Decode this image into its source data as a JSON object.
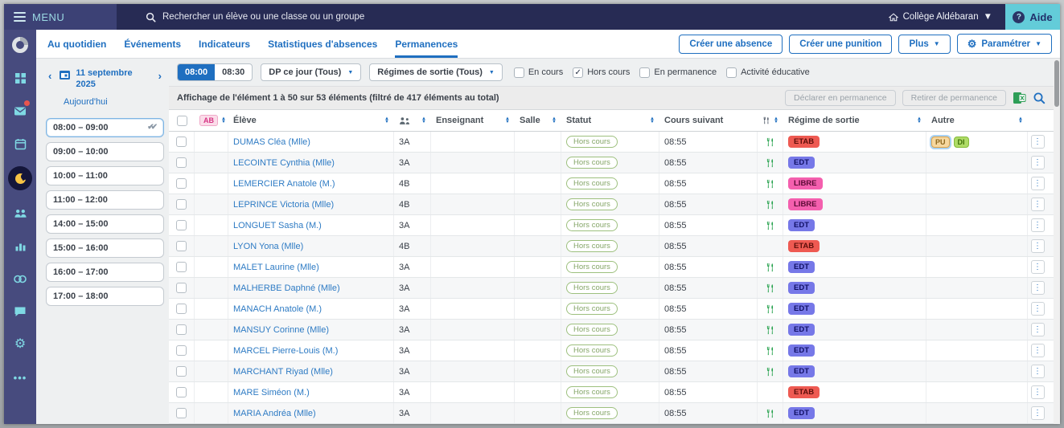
{
  "topbar": {
    "menu_label": "MENU",
    "search_placeholder": "Rechercher un élève ou une classe ou un groupe",
    "school_name": "Collège Aldébaran",
    "help_label": "Aide"
  },
  "sidebar_icons": [
    "pronote-logo",
    "dashboard-grid-icon",
    "messages-icon",
    "calendar-icon",
    "vie-scolaire-icon",
    "students-icon",
    "stats-icon",
    "links-icon",
    "chat-icon",
    "settings-icon",
    "more-icon"
  ],
  "tabs": [
    {
      "label": "Au quotidien",
      "active": false
    },
    {
      "label": "Événements",
      "active": false
    },
    {
      "label": "Indicateurs",
      "active": false
    },
    {
      "label": "Statistiques d'absences",
      "active": false
    },
    {
      "label": "Permanences",
      "active": true
    }
  ],
  "actions": {
    "create_absence": "Créer une absence",
    "create_punition": "Créer une punition",
    "plus": "Plus",
    "parametrer": "Paramétrer"
  },
  "datebar": {
    "prev": "‹",
    "next": "›",
    "date_line1": "11 septembre",
    "date_line2": "2025",
    "today": "Aujourd'hui"
  },
  "timeslots": [
    {
      "label": "08:00 – 09:00",
      "selected": true
    },
    {
      "label": "09:00 – 10:00",
      "selected": false
    },
    {
      "label": "10:00 – 11:00",
      "selected": false
    },
    {
      "label": "11:00 – 12:00",
      "selected": false
    },
    {
      "label": "14:00 – 15:00",
      "selected": false
    },
    {
      "label": "15:00 – 16:00",
      "selected": false
    },
    {
      "label": "16:00 – 17:00",
      "selected": false
    },
    {
      "label": "17:00 – 18:00",
      "selected": false
    }
  ],
  "filters": {
    "time_toggle": [
      {
        "label": "08:00",
        "active": true
      },
      {
        "label": "08:30",
        "active": false
      }
    ],
    "dropdown_dp": "DP ce jour (Tous)",
    "dropdown_regimes": "Régimes de sortie (Tous)",
    "checkboxes": [
      {
        "label": "En cours",
        "checked": false
      },
      {
        "label": "Hors cours",
        "checked": true
      },
      {
        "label": "En permanence",
        "checked": false
      },
      {
        "label": "Activité éducative",
        "checked": false
      }
    ]
  },
  "inforow": {
    "text": "Affichage de l'élément 1 à 50 sur 53 éléments (filtré de 417 éléments au total)",
    "declare_btn": "Déclarer en permanence",
    "retirer_btn": "Retirer de permanence",
    "excel_icon": "excel-export-icon",
    "search_icon": "table-search-icon"
  },
  "table": {
    "headers": {
      "ab": "AB",
      "eleve": "Élève",
      "classe_icon": "class-group-icon",
      "enseignant": "Enseignant",
      "salle": "Salle",
      "statut": "Statut",
      "cours_suivant": "Cours suivant",
      "demi_pension_icon": "fork-knife-icon",
      "regime": "Régime de sortie",
      "autre": "Autre"
    },
    "rows": [
      {
        "name": "DUMAS Cléa (Mlle)",
        "classe": "3A",
        "enseignant": "",
        "salle": "",
        "statut": "Hors cours",
        "cours_suivant": "08:55",
        "demi_pension": true,
        "regime": "ETAB",
        "autre": [
          "PU",
          "DI"
        ]
      },
      {
        "name": "LECOINTE Cynthia (Mlle)",
        "classe": "3A",
        "enseignant": "",
        "salle": "",
        "statut": "Hors cours",
        "cours_suivant": "08:55",
        "demi_pension": true,
        "regime": "EDT",
        "autre": []
      },
      {
        "name": "LEMERCIER Anatole (M.)",
        "classe": "4B",
        "enseignant": "",
        "salle": "",
        "statut": "Hors cours",
        "cours_suivant": "08:55",
        "demi_pension": true,
        "regime": "LIBRE",
        "autre": []
      },
      {
        "name": "LEPRINCE Victoria (Mlle)",
        "classe": "4B",
        "enseignant": "",
        "salle": "",
        "statut": "Hors cours",
        "cours_suivant": "08:55",
        "demi_pension": true,
        "regime": "LIBRE",
        "autre": []
      },
      {
        "name": "LONGUET Sasha (M.)",
        "classe": "3A",
        "enseignant": "",
        "salle": "",
        "statut": "Hors cours",
        "cours_suivant": "08:55",
        "demi_pension": true,
        "regime": "EDT",
        "autre": []
      },
      {
        "name": "LYON Yona (Mlle)",
        "classe": "4B",
        "enseignant": "",
        "salle": "",
        "statut": "Hors cours",
        "cours_suivant": "08:55",
        "demi_pension": false,
        "regime": "ETAB",
        "autre": []
      },
      {
        "name": "MALET Laurine (Mlle)",
        "classe": "3A",
        "enseignant": "",
        "salle": "",
        "statut": "Hors cours",
        "cours_suivant": "08:55",
        "demi_pension": true,
        "regime": "EDT",
        "autre": []
      },
      {
        "name": "MALHERBE Daphné (Mlle)",
        "classe": "3A",
        "enseignant": "",
        "salle": "",
        "statut": "Hors cours",
        "cours_suivant": "08:55",
        "demi_pension": true,
        "regime": "EDT",
        "autre": []
      },
      {
        "name": "MANACH Anatole (M.)",
        "classe": "3A",
        "enseignant": "",
        "salle": "",
        "statut": "Hors cours",
        "cours_suivant": "08:55",
        "demi_pension": true,
        "regime": "EDT",
        "autre": []
      },
      {
        "name": "MANSUY Corinne (Mlle)",
        "classe": "3A",
        "enseignant": "",
        "salle": "",
        "statut": "Hors cours",
        "cours_suivant": "08:55",
        "demi_pension": true,
        "regime": "EDT",
        "autre": []
      },
      {
        "name": "MARCEL Pierre-Louis (M.)",
        "classe": "3A",
        "enseignant": "",
        "salle": "",
        "statut": "Hors cours",
        "cours_suivant": "08:55",
        "demi_pension": true,
        "regime": "EDT",
        "autre": []
      },
      {
        "name": "MARCHANT Riyad (Mlle)",
        "classe": "3A",
        "enseignant": "",
        "salle": "",
        "statut": "Hors cours",
        "cours_suivant": "08:55",
        "demi_pension": true,
        "regime": "EDT",
        "autre": []
      },
      {
        "name": "MARE Siméon (M.)",
        "classe": "3A",
        "enseignant": "",
        "salle": "",
        "statut": "Hors cours",
        "cours_suivant": "08:55",
        "demi_pension": false,
        "regime": "ETAB",
        "autre": []
      },
      {
        "name": "MARIA Andréa (Mlle)",
        "classe": "3A",
        "enseignant": "",
        "salle": "",
        "statut": "Hors cours",
        "cours_suivant": "08:55",
        "demi_pension": true,
        "regime": "EDT",
        "autre": []
      }
    ]
  },
  "colors": {
    "topbar_bg": "#272b54",
    "sidebar_bg": "#474b7e",
    "accent_blue": "#1f6fc0",
    "help_bg": "#63ccd9",
    "active_icon_yellow": "#f6c344",
    "fork_green": "#22a04a",
    "statut_pill": {
      "border": "#9dc07e",
      "fg": "#85a668"
    },
    "badges": {
      "ETAB": {
        "bg": "#ee5a52",
        "fg": "#5c0f0b"
      },
      "EDT": {
        "bg": "#7678e8",
        "fg": "#101065"
      },
      "LIBRE": {
        "bg": "#f45fae",
        "fg": "#5c0b36"
      },
      "PU": {
        "bg": "#f6d8a0",
        "fg": "#8a651c",
        "border": "#dca24a",
        "ring": true
      },
      "DI": {
        "bg": "#aedb66",
        "fg": "#3f7209",
        "border": "#85bb3a",
        "ring": false
      }
    }
  }
}
